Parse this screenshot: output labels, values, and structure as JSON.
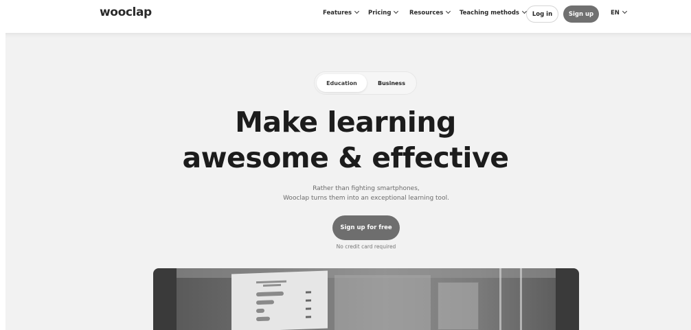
{
  "header": {
    "logo": "wooclap",
    "nav": [
      {
        "label": "Features"
      },
      {
        "label": "Pricing"
      },
      {
        "label": "Resources"
      },
      {
        "label": "Teaching methods"
      }
    ],
    "login_label": "Log in",
    "signup_label": "Sign up",
    "language": "EN"
  },
  "hero": {
    "tabs": [
      "Education",
      "Business"
    ],
    "active_tab": "Education",
    "title_line1": "Make learning",
    "title_line2": "awesome & effective",
    "subtitle_line1": "Rather than fighting smartphones,",
    "subtitle_line2": "Wooclap turns them into an exceptional learning tool.",
    "cta_label": "Sign up for free",
    "cta_note": "No credit card required"
  },
  "colors": {
    "accent_button": "#707070",
    "hero_background": "#f2f2f2",
    "text_dark": "#1c1c1c"
  }
}
